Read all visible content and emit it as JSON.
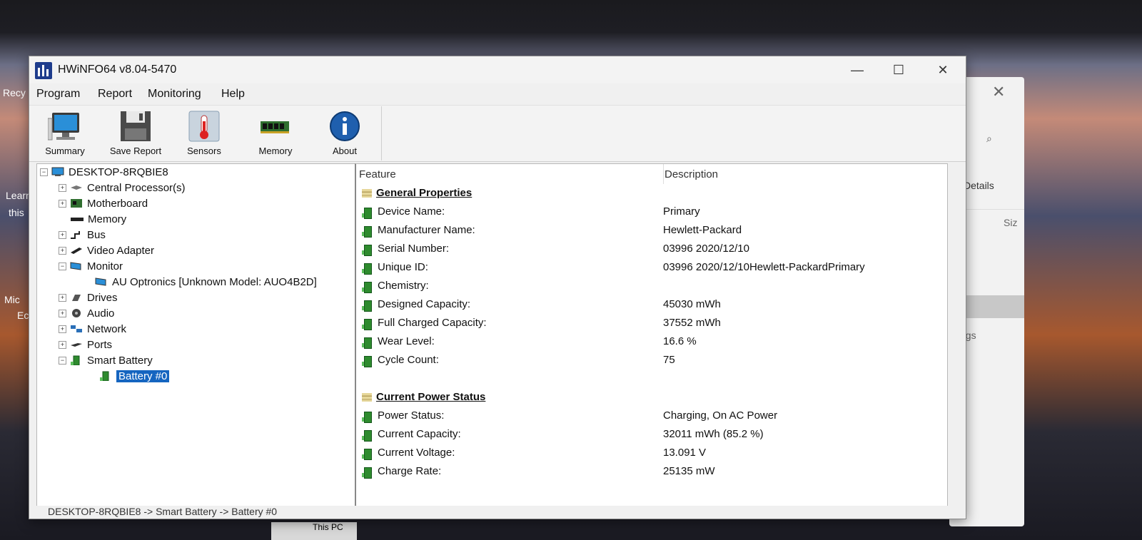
{
  "desktop": {
    "icons": [
      "Recy",
      "Learn",
      "this",
      "Mic",
      "Ec"
    ]
  },
  "bg_window": {
    "details": "Details",
    "siz": "Siz",
    "tings": "tings",
    "this_pc": "This PC"
  },
  "window": {
    "title": "HWiNFO64 v8.04-5470",
    "controls": {
      "minimize": "—",
      "maximize": "☐",
      "close": "✕"
    }
  },
  "menu": [
    "Program",
    "Report",
    "Monitoring",
    "Help"
  ],
  "toolbar": {
    "summary": "Summary",
    "save_report": "Save Report",
    "sensors": "Sensors",
    "memory": "Memory",
    "about": "About"
  },
  "tree": {
    "root": "DESKTOP-8RQBIE8",
    "items": [
      {
        "label": "Central Processor(s)"
      },
      {
        "label": "Motherboard"
      },
      {
        "label": "Memory"
      },
      {
        "label": "Bus"
      },
      {
        "label": "Video Adapter"
      },
      {
        "label": "Monitor"
      },
      {
        "label": "AU Optronics [Unknown Model: AUO4B2D]"
      },
      {
        "label": "Drives"
      },
      {
        "label": "Audio"
      },
      {
        "label": "Network"
      },
      {
        "label": "Ports"
      },
      {
        "label": "Smart Battery"
      },
      {
        "label": "Battery #0"
      }
    ]
  },
  "details": {
    "col_feature": "Feature",
    "col_description": "Description",
    "section1": "General Properties",
    "general": [
      {
        "feature": "Device Name:",
        "value": "Primary"
      },
      {
        "feature": "Manufacturer Name:",
        "value": "Hewlett-Packard"
      },
      {
        "feature": "Serial Number:",
        "value": "03996 2020/12/10"
      },
      {
        "feature": "Unique ID:",
        "value": "03996 2020/12/10Hewlett-PackardPrimary"
      },
      {
        "feature": "Chemistry:",
        "value": ""
      },
      {
        "feature": "Designed Capacity:",
        "value": "45030 mWh"
      },
      {
        "feature": "Full Charged Capacity:",
        "value": "37552 mWh"
      },
      {
        "feature": "Wear Level:",
        "value": "16.6 %"
      },
      {
        "feature": "Cycle Count:",
        "value": "75"
      }
    ],
    "section2": "Current Power Status",
    "power": [
      {
        "feature": "Power Status:",
        "value": "Charging, On AC Power"
      },
      {
        "feature": "Current Capacity:",
        "value": "32011 mWh (85.2 %)"
      },
      {
        "feature": "Current Voltage:",
        "value": "13.091 V"
      },
      {
        "feature": "Charge Rate:",
        "value": "25135 mW"
      }
    ]
  },
  "status": "DESKTOP-8RQBIE8 -> Smart Battery -> Battery #0"
}
